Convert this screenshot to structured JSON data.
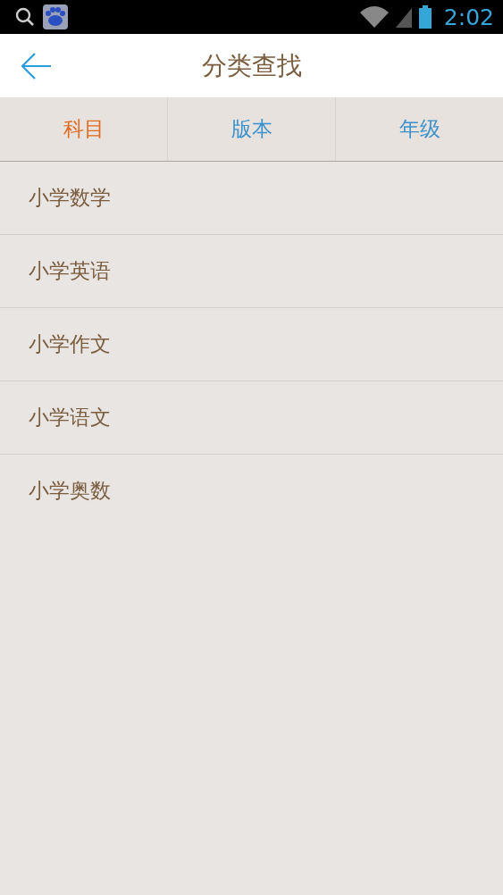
{
  "status_bar": {
    "time": "2:02"
  },
  "header": {
    "title": "分类查找"
  },
  "tabs": [
    {
      "label": "科目",
      "selected": true
    },
    {
      "label": "版本",
      "selected": false
    },
    {
      "label": "年级",
      "selected": false
    }
  ],
  "items": [
    "小学数学",
    "小学英语",
    "小学作文",
    "小学语文",
    "小学奥数"
  ]
}
